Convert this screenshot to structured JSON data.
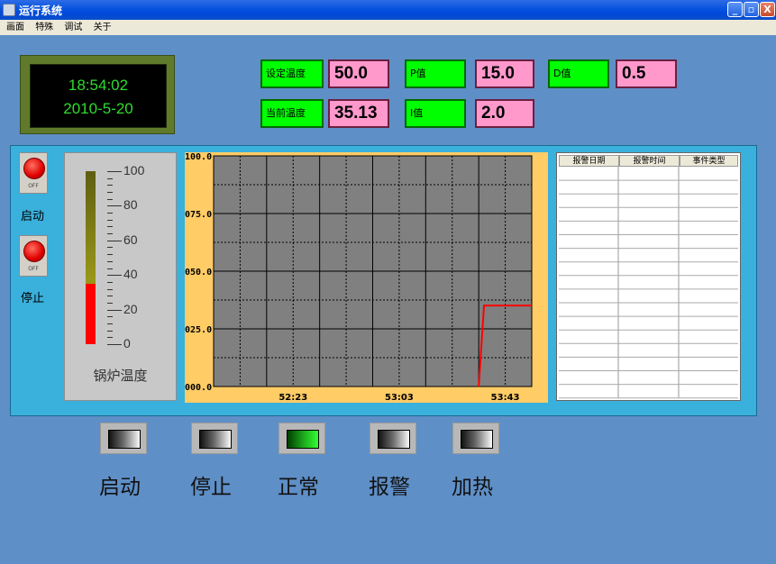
{
  "window": {
    "title": "运行系统",
    "minimize": "_",
    "restore": "▫",
    "close": "X"
  },
  "menu": [
    "画面",
    "特殊",
    "调试",
    "关于"
  ],
  "clock": {
    "time": "18:54:02",
    "date": "2010-5-20"
  },
  "params": {
    "set_temp_label": "设定温度",
    "set_temp_value": "50.0",
    "cur_temp_label": "当前温度",
    "cur_temp_value": "35.13",
    "p_label": "P值",
    "p_value": "15.0",
    "i_label": "I值",
    "i_value": "2.0",
    "d_label": "D值",
    "d_value": "0.5"
  },
  "switches": [
    {
      "state": "OFF",
      "label": "启动"
    },
    {
      "state": "OFF",
      "label": "停止"
    }
  ],
  "thermometer": {
    "label": "锅炉温度",
    "ticks": [
      "100",
      "80",
      "60",
      "40",
      "20",
      "0"
    ],
    "value": 35.13,
    "max": 100,
    "colors": {
      "fill": "#ff0000",
      "track": "#bbb81c"
    }
  },
  "chart_data": {
    "type": "line",
    "y_ticks": [
      "100.0",
      "075.0",
      "050.0",
      "025.0",
      "000.0"
    ],
    "x_ticks": [
      "52:23",
      "53:03",
      "53:43"
    ],
    "ylim": [
      0,
      100
    ],
    "xlim": [
      0,
      12
    ],
    "grid": true,
    "series": [
      {
        "x": [
          10.0,
          10.2,
          12.0
        ],
        "y": [
          0,
          35.13,
          35.13
        ],
        "color": "#ff0000"
      }
    ]
  },
  "alarm_table": {
    "headers": [
      "报警日期",
      "报警时间",
      "事件类型"
    ],
    "rows": []
  },
  "indicators": [
    {
      "label": "启动",
      "state": "off"
    },
    {
      "label": "停止",
      "state": "off"
    },
    {
      "label": "正常",
      "state": "on"
    },
    {
      "label": "报警",
      "state": "off"
    },
    {
      "label": "加热",
      "state": "off"
    }
  ]
}
